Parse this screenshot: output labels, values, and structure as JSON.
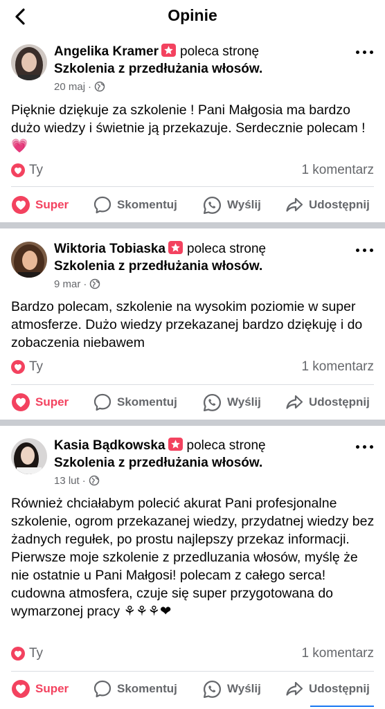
{
  "header": {
    "title": "Opinie"
  },
  "colors": {
    "brand_pink": "#f3425f",
    "secondary_text": "#65676b",
    "separator": "#c9ccd1"
  },
  "actions": {
    "like": "Super",
    "comment": "Skomentuj",
    "send": "Wyślij",
    "share": "Udostępnij"
  },
  "posts": [
    {
      "author": "Angelika Kramer",
      "recommends": "poleca stronę",
      "page": "Szkolenia z przedłużania włosów.",
      "date": "20 maj",
      "text": "Pięknie dziękuje za szkolenie ! Pani Małgosia ma bardzo dużo wiedzy i świetnie ją przekazuje. Serdecznie polecam ! 💗",
      "reactor": "Ty",
      "comments": "1 komentarz"
    },
    {
      "author": "Wiktoria Tobiaska",
      "recommends": "poleca stronę",
      "page": "Szkolenia z przedłużania włosów.",
      "date": "9 mar",
      "text": "Bardzo polecam, szkolenie na wysokim poziomie w super atmosferze. Dużo wiedzy przekazanej bardzo dziękuję i do zobaczenia niebawem",
      "reactor": "Ty",
      "comments": "1 komentarz"
    },
    {
      "author": "Kasia Bądkowska",
      "recommends": "poleca stronę",
      "page": "Szkolenia z przedłużania włosów.",
      "date": "13 lut",
      "text": "Również chciałabym polecić akurat Pani profesjonalne szkolenie, ogrom przekazanej wiedzy, przydatnej wiedzy bez żadnych regułek, po prostu najlepszy przekaz informacji. Pierwsze moje szkolenie z przedluzania włosów, myślę że nie ostatnie u Pani Małgosi! polecam z całego serca! cudowna atmosfera, czuje się super przygotowana do wymarzonej pracy ⚘⚘⚘❤",
      "reactor": "Ty",
      "comments": "1 komentarz"
    }
  ]
}
